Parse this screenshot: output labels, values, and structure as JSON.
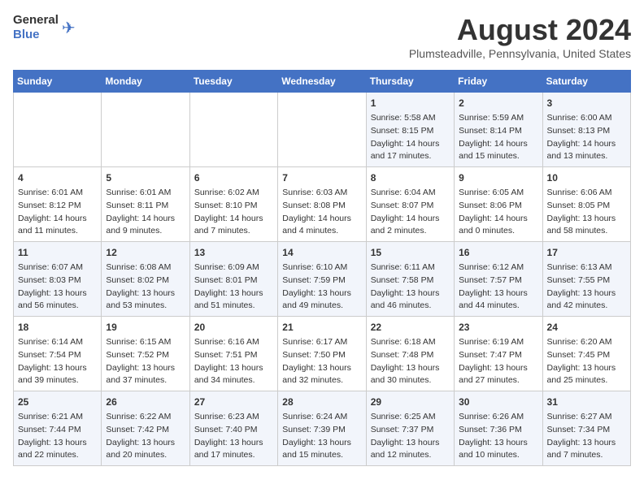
{
  "header": {
    "logo_general": "General",
    "logo_blue": "Blue",
    "main_title": "August 2024",
    "subtitle": "Plumsteadville, Pennsylvania, United States"
  },
  "calendar": {
    "weekdays": [
      "Sunday",
      "Monday",
      "Tuesday",
      "Wednesday",
      "Thursday",
      "Friday",
      "Saturday"
    ],
    "weeks": [
      [
        {
          "day": "",
          "info": ""
        },
        {
          "day": "",
          "info": ""
        },
        {
          "day": "",
          "info": ""
        },
        {
          "day": "",
          "info": ""
        },
        {
          "day": "1",
          "info": "Sunrise: 5:58 AM\nSunset: 8:15 PM\nDaylight: 14 hours\nand 17 minutes."
        },
        {
          "day": "2",
          "info": "Sunrise: 5:59 AM\nSunset: 8:14 PM\nDaylight: 14 hours\nand 15 minutes."
        },
        {
          "day": "3",
          "info": "Sunrise: 6:00 AM\nSunset: 8:13 PM\nDaylight: 14 hours\nand 13 minutes."
        }
      ],
      [
        {
          "day": "4",
          "info": "Sunrise: 6:01 AM\nSunset: 8:12 PM\nDaylight: 14 hours\nand 11 minutes."
        },
        {
          "day": "5",
          "info": "Sunrise: 6:01 AM\nSunset: 8:11 PM\nDaylight: 14 hours\nand 9 minutes."
        },
        {
          "day": "6",
          "info": "Sunrise: 6:02 AM\nSunset: 8:10 PM\nDaylight: 14 hours\nand 7 minutes."
        },
        {
          "day": "7",
          "info": "Sunrise: 6:03 AM\nSunset: 8:08 PM\nDaylight: 14 hours\nand 4 minutes."
        },
        {
          "day": "8",
          "info": "Sunrise: 6:04 AM\nSunset: 8:07 PM\nDaylight: 14 hours\nand 2 minutes."
        },
        {
          "day": "9",
          "info": "Sunrise: 6:05 AM\nSunset: 8:06 PM\nDaylight: 14 hours\nand 0 minutes."
        },
        {
          "day": "10",
          "info": "Sunrise: 6:06 AM\nSunset: 8:05 PM\nDaylight: 13 hours\nand 58 minutes."
        }
      ],
      [
        {
          "day": "11",
          "info": "Sunrise: 6:07 AM\nSunset: 8:03 PM\nDaylight: 13 hours\nand 56 minutes."
        },
        {
          "day": "12",
          "info": "Sunrise: 6:08 AM\nSunset: 8:02 PM\nDaylight: 13 hours\nand 53 minutes."
        },
        {
          "day": "13",
          "info": "Sunrise: 6:09 AM\nSunset: 8:01 PM\nDaylight: 13 hours\nand 51 minutes."
        },
        {
          "day": "14",
          "info": "Sunrise: 6:10 AM\nSunset: 7:59 PM\nDaylight: 13 hours\nand 49 minutes."
        },
        {
          "day": "15",
          "info": "Sunrise: 6:11 AM\nSunset: 7:58 PM\nDaylight: 13 hours\nand 46 minutes."
        },
        {
          "day": "16",
          "info": "Sunrise: 6:12 AM\nSunset: 7:57 PM\nDaylight: 13 hours\nand 44 minutes."
        },
        {
          "day": "17",
          "info": "Sunrise: 6:13 AM\nSunset: 7:55 PM\nDaylight: 13 hours\nand 42 minutes."
        }
      ],
      [
        {
          "day": "18",
          "info": "Sunrise: 6:14 AM\nSunset: 7:54 PM\nDaylight: 13 hours\nand 39 minutes."
        },
        {
          "day": "19",
          "info": "Sunrise: 6:15 AM\nSunset: 7:52 PM\nDaylight: 13 hours\nand 37 minutes."
        },
        {
          "day": "20",
          "info": "Sunrise: 6:16 AM\nSunset: 7:51 PM\nDaylight: 13 hours\nand 34 minutes."
        },
        {
          "day": "21",
          "info": "Sunrise: 6:17 AM\nSunset: 7:50 PM\nDaylight: 13 hours\nand 32 minutes."
        },
        {
          "day": "22",
          "info": "Sunrise: 6:18 AM\nSunset: 7:48 PM\nDaylight: 13 hours\nand 30 minutes."
        },
        {
          "day": "23",
          "info": "Sunrise: 6:19 AM\nSunset: 7:47 PM\nDaylight: 13 hours\nand 27 minutes."
        },
        {
          "day": "24",
          "info": "Sunrise: 6:20 AM\nSunset: 7:45 PM\nDaylight: 13 hours\nand 25 minutes."
        }
      ],
      [
        {
          "day": "25",
          "info": "Sunrise: 6:21 AM\nSunset: 7:44 PM\nDaylight: 13 hours\nand 22 minutes."
        },
        {
          "day": "26",
          "info": "Sunrise: 6:22 AM\nSunset: 7:42 PM\nDaylight: 13 hours\nand 20 minutes."
        },
        {
          "day": "27",
          "info": "Sunrise: 6:23 AM\nSunset: 7:40 PM\nDaylight: 13 hours\nand 17 minutes."
        },
        {
          "day": "28",
          "info": "Sunrise: 6:24 AM\nSunset: 7:39 PM\nDaylight: 13 hours\nand 15 minutes."
        },
        {
          "day": "29",
          "info": "Sunrise: 6:25 AM\nSunset: 7:37 PM\nDaylight: 13 hours\nand 12 minutes."
        },
        {
          "day": "30",
          "info": "Sunrise: 6:26 AM\nSunset: 7:36 PM\nDaylight: 13 hours\nand 10 minutes."
        },
        {
          "day": "31",
          "info": "Sunrise: 6:27 AM\nSunset: 7:34 PM\nDaylight: 13 hours\nand 7 minutes."
        }
      ]
    ]
  }
}
